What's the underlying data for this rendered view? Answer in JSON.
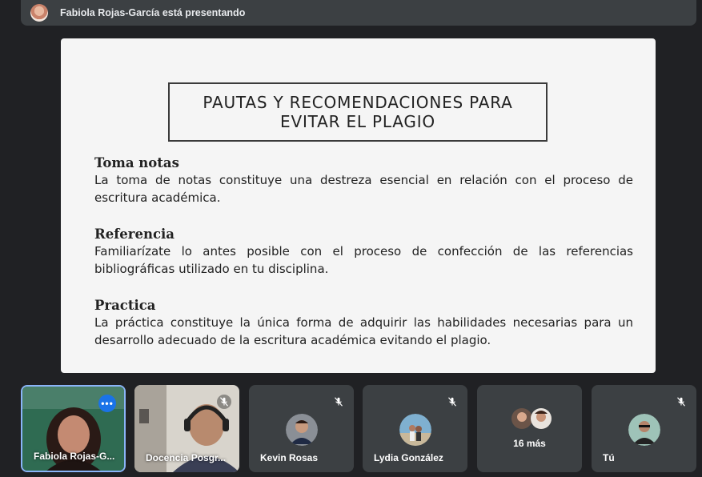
{
  "topbar": {
    "presenter_text": "Fabiola Rojas-García está presentando"
  },
  "slide": {
    "title_line1": "PAUTAS Y RECOMENDACIONES PARA",
    "title_line2": "EVITAR EL PLAGIO",
    "sections": [
      {
        "heading": "Toma notas",
        "body": "La toma de notas constituye una destreza esencial en relación con el proceso de escritura académica."
      },
      {
        "heading": "Referencia",
        "body": "Familiarízate lo antes posible con el proceso de confección de las referencias bibliográficas utilizado en tu disciplina."
      },
      {
        "heading": "Practica",
        "body": "La práctica constituye la única forma de adquirir las habilidades necesarias para un desarrollo adecuado de la escritura académica evitando el plagio."
      }
    ]
  },
  "participants": [
    {
      "name": "Fabiola Rojas-G...",
      "icon": "more-options-icon"
    },
    {
      "name": "Docencia Posgr...",
      "icon": "mic-off-icon"
    },
    {
      "name": "Kevin Rosas",
      "icon": "mic-off-icon"
    },
    {
      "name": "Lydia González",
      "icon": "mic-off-icon"
    },
    {
      "more_label": "16 más"
    },
    {
      "name": "Tú",
      "icon": "mic-off-icon"
    }
  ],
  "colors": {
    "background": "#202124",
    "tile": "#3c4043",
    "active_border": "#8ab4f8",
    "accent": "#1a73e8"
  }
}
